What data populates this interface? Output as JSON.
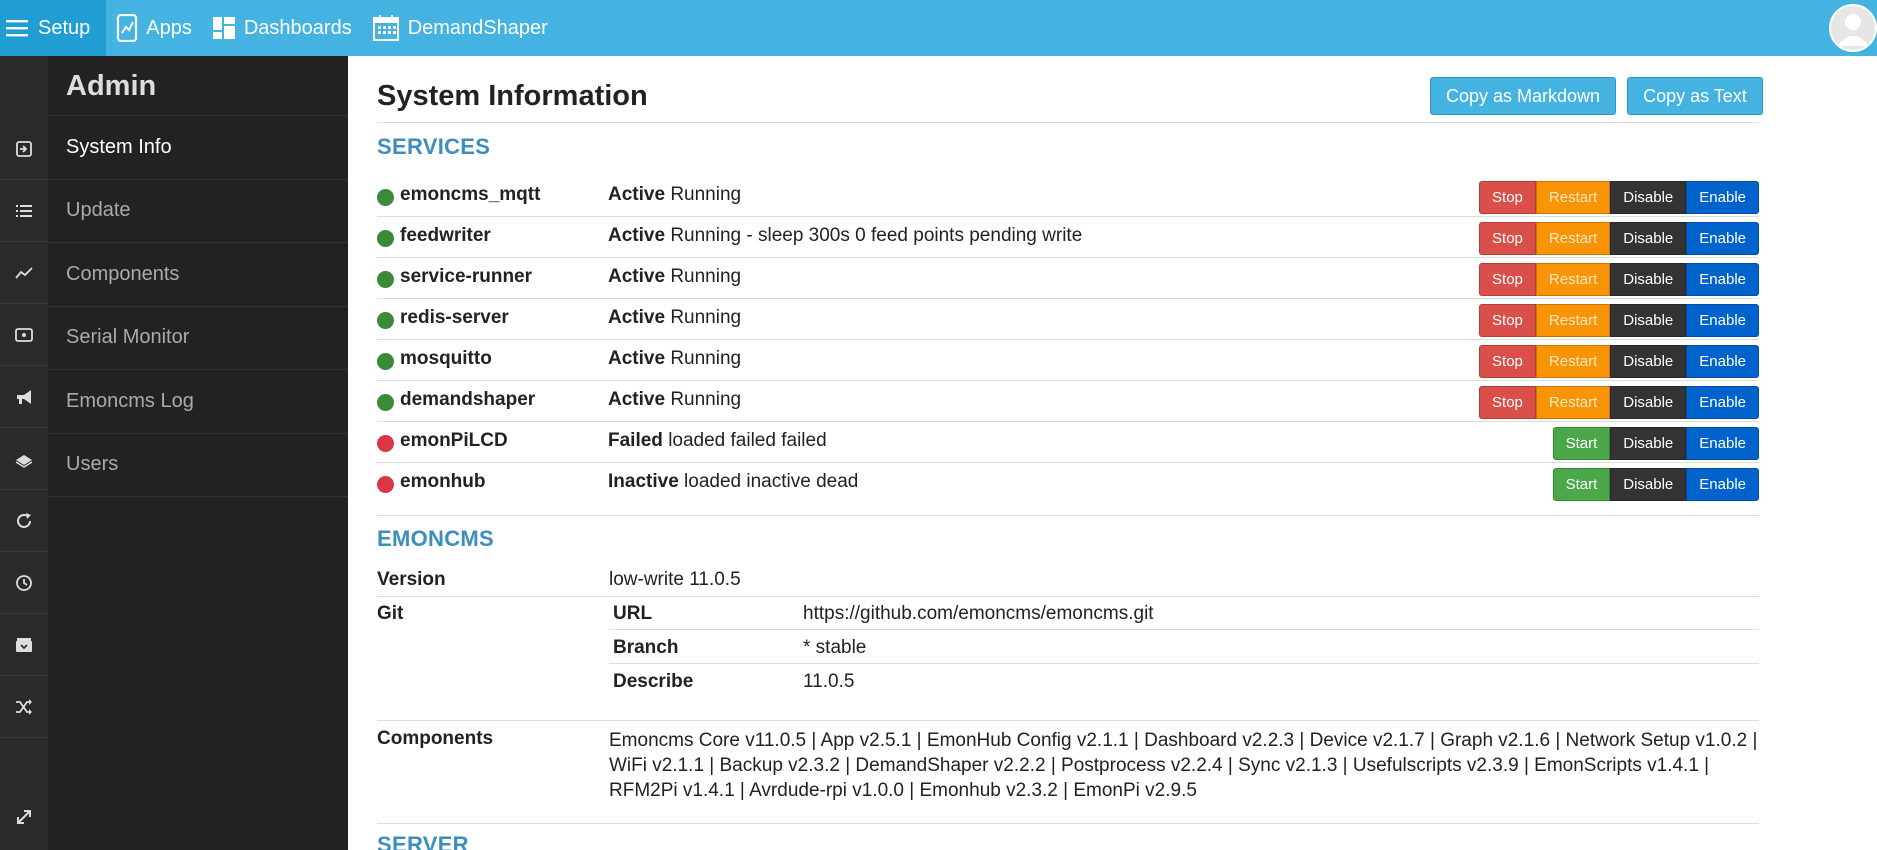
{
  "topbar": {
    "items": [
      {
        "label": "Setup",
        "icon": "hamburger-icon"
      },
      {
        "label": "Apps",
        "icon": "apps-icon"
      },
      {
        "label": "Dashboards",
        "icon": "dashboards-icon"
      },
      {
        "label": "DemandShaper",
        "icon": "calendar-icon"
      }
    ]
  },
  "sidebar": {
    "title": "Admin",
    "items": [
      {
        "label": "System Info"
      },
      {
        "label": "Update"
      },
      {
        "label": "Components"
      },
      {
        "label": "Serial Monitor"
      },
      {
        "label": "Emoncms Log"
      },
      {
        "label": "Users"
      }
    ]
  },
  "iconbar": [
    "login-icon",
    "list-icon",
    "graph-icon",
    "monitor-icon",
    "megaphone-icon",
    "book-icon",
    "refresh-icon",
    "clock-icon",
    "archive-icon",
    "shuffle-icon",
    "expand-icon"
  ],
  "page": {
    "title": "System Information",
    "copy_markdown": "Copy as Markdown",
    "copy_text": "Copy as Text"
  },
  "services": {
    "heading": "SERVICES",
    "rows": [
      {
        "name": "emoncms_mqtt",
        "state": "Active",
        "detail": "Running",
        "ok": true
      },
      {
        "name": "feedwriter",
        "state": "Active",
        "detail": "Running - sleep 300s 0 feed points pending write",
        "ok": true
      },
      {
        "name": "service-runner",
        "state": "Active",
        "detail": "Running",
        "ok": true
      },
      {
        "name": "redis-server",
        "state": "Active",
        "detail": "Running",
        "ok": true
      },
      {
        "name": "mosquitto",
        "state": "Active",
        "detail": "Running",
        "ok": true
      },
      {
        "name": "demandshaper",
        "state": "Active",
        "detail": "Running",
        "ok": true
      },
      {
        "name": "emonPiLCD",
        "state": "Failed",
        "detail": "loaded failed failed",
        "ok": false
      },
      {
        "name": "emonhub",
        "state": "Inactive",
        "detail": "loaded inactive dead",
        "ok": false
      }
    ],
    "btn_stop": "Stop",
    "btn_restart": "Restart",
    "btn_disable": "Disable",
    "btn_enable": "Enable",
    "btn_start": "Start"
  },
  "emoncms": {
    "heading": "EMONCMS",
    "version_label": "Version",
    "version_value": "low-write 11.0.5",
    "git_label": "Git",
    "git": [
      {
        "k": "URL",
        "v": "https://github.com/emoncms/emoncms.git"
      },
      {
        "k": "Branch",
        "v": "* stable"
      },
      {
        "k": "Describe",
        "v": "11.0.5"
      }
    ],
    "components_label": "Components",
    "components_value": "Emoncms Core v11.0.5 | App v2.5.1 | EmonHub Config v2.1.1 | Dashboard v2.2.3 | Device v2.1.7 | Graph v2.1.6 | Network Setup v1.0.2 | WiFi v2.1.1 | Backup v2.3.2 | DemandShaper v2.2.2 | Postprocess v2.2.4 | Sync v2.1.3 | Usefulscripts v2.3.9 | EmonScripts v1.4.1 | RFM2Pi v1.4.1 | Avrdude-rpi v1.0.0 | Emonhub v2.3.2 | EmonPi v2.9.5"
  },
  "server": {
    "heading": "SERVER"
  },
  "colors": {
    "topbar": "#44b3e2",
    "active_dot": "#3a8a3a",
    "failed_dot": "#dc3545"
  }
}
